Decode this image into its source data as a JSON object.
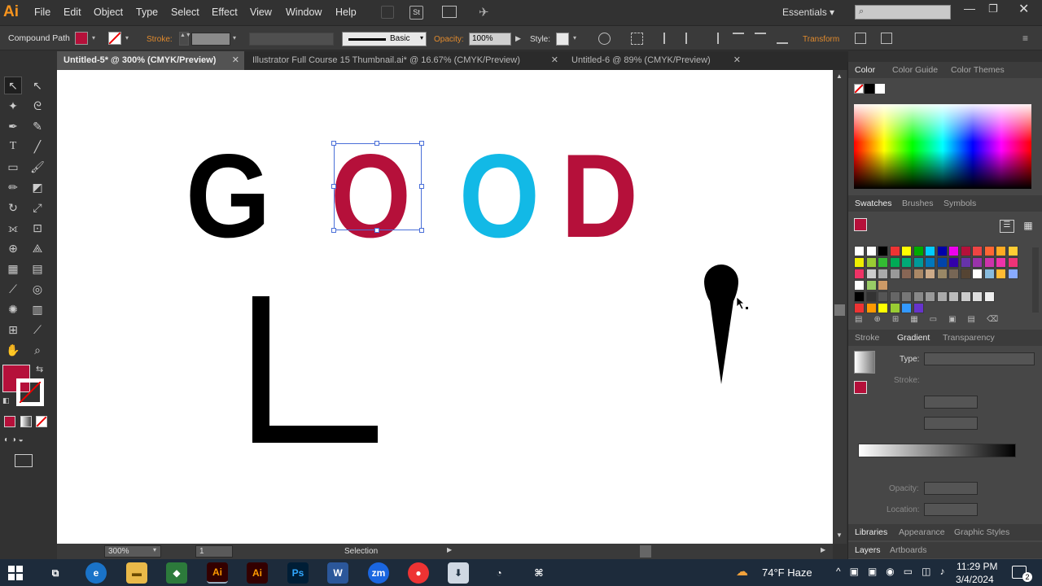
{
  "app": {
    "logo": "Ai",
    "workspace": "Essentials"
  },
  "menu": [
    "File",
    "Edit",
    "Object",
    "Type",
    "Select",
    "Effect",
    "View",
    "Window",
    "Help"
  ],
  "control": {
    "object_type": "Compound Path",
    "stroke_label": "Stroke:",
    "brush": "Basic",
    "opacity_label": "Opacity:",
    "opacity_value": "100%",
    "style_label": "Style:",
    "transform_label": "Transform"
  },
  "tabs": [
    "Untitled-5* @ 300% (CMYK/Preview)",
    "Illustrator Full Course  15 Thumbnail.ai* @ 16.67% (CMYK/Preview)",
    "Untitled-6 @ 89% (CMYK/Preview)"
  ],
  "artwork": {
    "letter_g": "G",
    "letter_o1": "O",
    "letter_o2": "O",
    "letter_d": "D",
    "letter_l": "L",
    "colors": {
      "black": "#000000",
      "red": "#b5103a",
      "cyan": "#12b9e6"
    }
  },
  "status": {
    "zoom": "300%",
    "page": "1",
    "tool": "Selection"
  },
  "panels": {
    "color_tabs": [
      "Color",
      "Color Guide",
      "Color Themes"
    ],
    "swatch_tabs": [
      "Swatches",
      "Brushes",
      "Symbols"
    ],
    "gradient_tabs": [
      "Stroke",
      "Gradient",
      "Transparency"
    ],
    "gradient": {
      "type_label": "Type:",
      "stroke_label": "Stroke:",
      "opacity_label": "Opacity:",
      "location_label": "Location:"
    },
    "bottom_tabs_1": [
      "Libraries",
      "Appearance",
      "Graphic Styles"
    ],
    "bottom_tabs_2": [
      "Layers",
      "Artboards"
    ]
  },
  "fill_color": "#b5103a",
  "taskbar": {
    "weather": "74°F  Haze",
    "time": "11:29 PM",
    "date": "3/4/2024",
    "notifications": "2"
  }
}
